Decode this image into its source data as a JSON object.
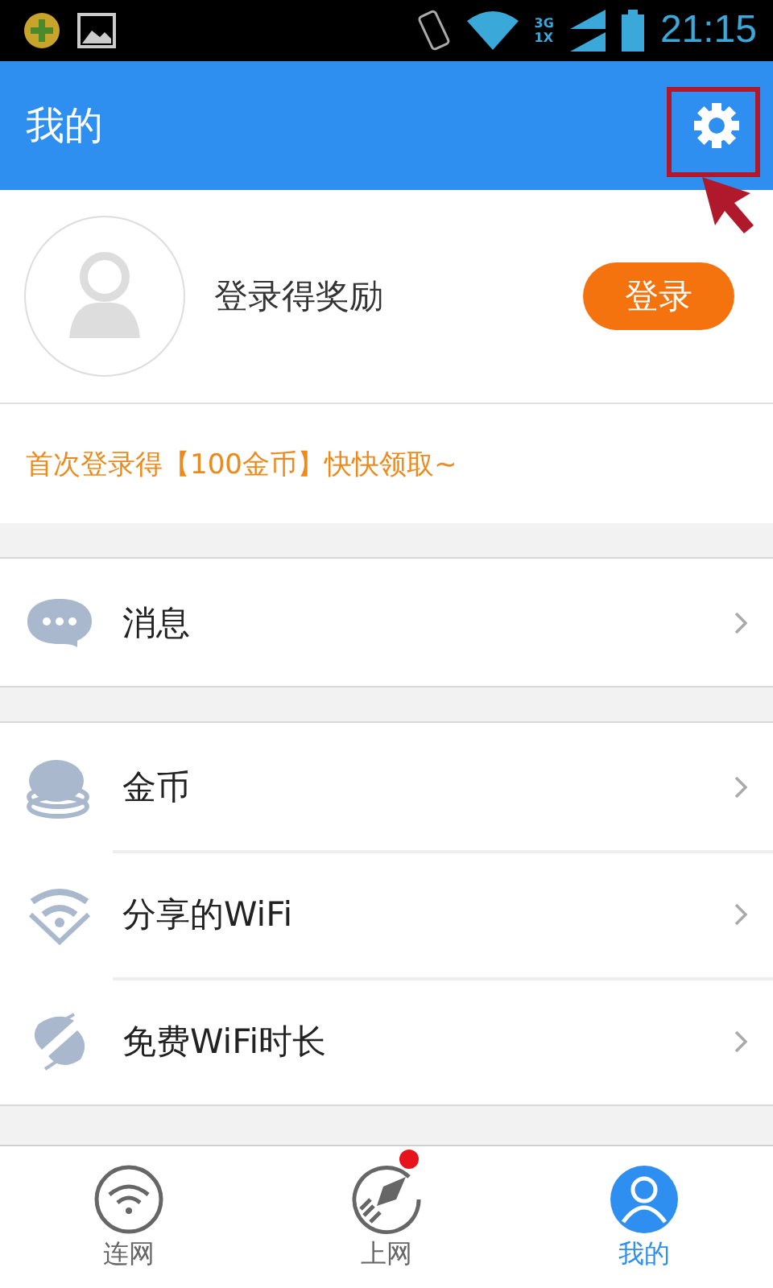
{
  "status_bar": {
    "time": "21:15",
    "network_top": "3G",
    "network_bottom": "1X"
  },
  "header": {
    "title": "我的",
    "settings_highlighted": true
  },
  "profile": {
    "prompt": "登录得奖励",
    "login_button": "登录"
  },
  "promo": "首次登录得【100金币】快快领取~",
  "groups": [
    [
      {
        "kind": "message",
        "label": "消息"
      }
    ],
    [
      {
        "kind": "coins",
        "label": "金币"
      },
      {
        "kind": "wifi",
        "label": "分享的WiFi"
      },
      {
        "kind": "carrier",
        "label": "免费WiFi时长"
      }
    ]
  ],
  "nav": [
    {
      "kind": "wifi",
      "label": "连网",
      "selected": false,
      "badge": false
    },
    {
      "kind": "rocket",
      "label": "上网",
      "selected": false,
      "badge": true
    },
    {
      "kind": "user",
      "label": "我的",
      "selected": true,
      "badge": false
    }
  ]
}
